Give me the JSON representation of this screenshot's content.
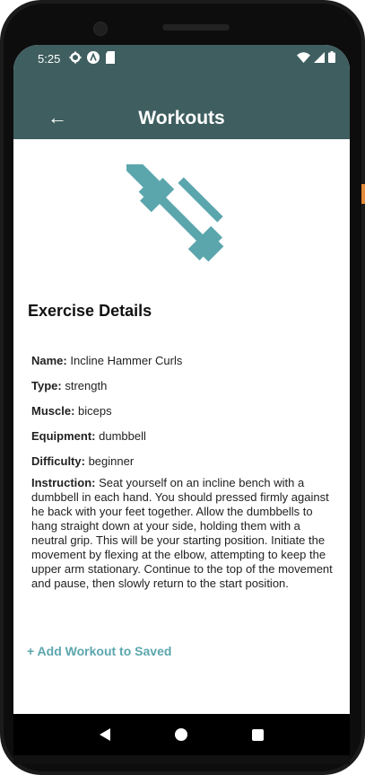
{
  "status_bar": {
    "time": "5:25",
    "left_icons": [
      "gear-icon",
      "a-icon",
      "sd-card-icon"
    ],
    "right_icons": [
      "wifi-icon",
      "signal-icon",
      "battery-icon"
    ]
  },
  "app_bar": {
    "title": "Workouts",
    "back_icon": "arrow-left-icon"
  },
  "hero_icon": "dumbbell-icon",
  "colors": {
    "header_bg": "#3f5e5f",
    "accent": "#5ba6ad",
    "text": "#222222"
  },
  "section_title": "Exercise Details",
  "details": {
    "name_label": "Name:",
    "name_value": "Incline Hammer Curls",
    "type_label": "Type:",
    "type_value": "strength",
    "muscle_label": "Muscle:",
    "muscle_value": "biceps",
    "equipment_label": "Equipment:",
    "equipment_value": "dumbbell",
    "difficulty_label": "Difficulty:",
    "difficulty_value": "beginner",
    "instruction_label": "Instruction:",
    "instruction_value": "Seat yourself on an incline bench with a dumbbell in each hand. You should pressed firmly against he back with your feet together. Allow the dumbbells to hang straight down at your side, holding them with a neutral grip. This will be your starting position. Initiate the movement by flexing at the elbow, attempting to keep the upper arm stationary. Continue to the top of the movement and pause, then slowly return to the start position."
  },
  "add_button_label": "+ Add Workout to Saved",
  "nav_bar": {
    "icons": [
      "nav-back-icon",
      "nav-home-icon",
      "nav-recents-icon"
    ]
  }
}
